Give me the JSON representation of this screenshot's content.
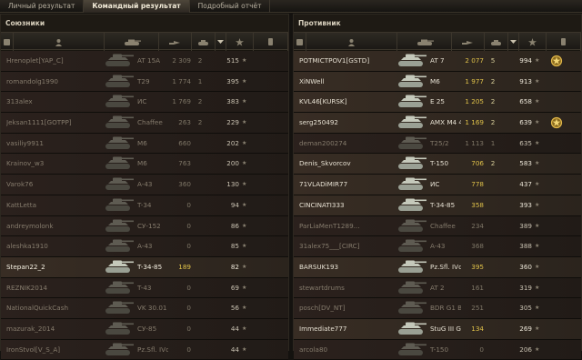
{
  "tabs": [
    "Личный результат",
    "Командный результат",
    "Подробный отчёт"
  ],
  "active_tab": 1,
  "colors": {
    "damage_highlight": "#e0c24a",
    "kills_highlight": "#d8ce9a",
    "alive_row": "#382d24",
    "dead_row": "#2b211d"
  },
  "header_icons": [
    "squad-icon",
    "player-icon",
    "tank-icon",
    "damage-icon",
    "kills-icon",
    "sort-arrow-icon",
    "experience-star-icon",
    "medal-icon"
  ],
  "allies": {
    "title": "Союзники",
    "rows": [
      {
        "name": "Hrenoplet[YAP_C]",
        "vehicle": "AT 15A",
        "damage": "2 309",
        "kills": "2",
        "xp": "515",
        "alive": false,
        "medal": false
      },
      {
        "name": "romandolg1990",
        "vehicle": "T29",
        "damage": "1 774",
        "kills": "1",
        "xp": "395",
        "alive": false,
        "medal": false
      },
      {
        "name": "313alex",
        "vehicle": "ИС",
        "damage": "1 769",
        "kills": "2",
        "xp": "383",
        "alive": false,
        "medal": false
      },
      {
        "name": "Jeksan1111[GOTPP]",
        "vehicle": "Chaffee",
        "damage": "263",
        "kills": "2",
        "xp": "229",
        "alive": false,
        "medal": false
      },
      {
        "name": "vasiliy9911",
        "vehicle": "M6",
        "damage": "660",
        "kills": "",
        "xp": "202",
        "alive": false,
        "medal": false
      },
      {
        "name": "Krainov_w3",
        "vehicle": "M6",
        "damage": "763",
        "kills": "",
        "xp": "200",
        "alive": false,
        "medal": false
      },
      {
        "name": "Varok76",
        "vehicle": "A-43",
        "damage": "360",
        "kills": "",
        "xp": "130",
        "alive": false,
        "medal": false
      },
      {
        "name": "KattLetta",
        "vehicle": "T-34",
        "damage": "0",
        "kills": "",
        "xp": "94",
        "alive": false,
        "medal": false
      },
      {
        "name": "andreymolonk",
        "vehicle": "СУ-152",
        "damage": "0",
        "kills": "",
        "xp": "86",
        "alive": false,
        "medal": false
      },
      {
        "name": "aleshka1910",
        "vehicle": "A-43",
        "damage": "0",
        "kills": "",
        "xp": "85",
        "alive": false,
        "medal": false
      },
      {
        "name": "Stepan22_2",
        "vehicle": "T-34-85",
        "damage": "189",
        "kills": "",
        "xp": "82",
        "alive": true,
        "self": true,
        "medal": false
      },
      {
        "name": "REZNIK2014",
        "vehicle": "T-43",
        "damage": "0",
        "kills": "",
        "xp": "69",
        "alive": false,
        "medal": false
      },
      {
        "name": "NationalQuickCash",
        "vehicle": "VK 30.01 H",
        "damage": "0",
        "kills": "",
        "xp": "56",
        "alive": false,
        "medal": false
      },
      {
        "name": "mazurak_2014",
        "vehicle": "СУ-85",
        "damage": "0",
        "kills": "",
        "xp": "44",
        "alive": false,
        "medal": false
      },
      {
        "name": "IronStvol[V_S_A]",
        "vehicle": "Pz.Sfl. IVc",
        "damage": "0",
        "kills": "",
        "xp": "44",
        "alive": false,
        "medal": false
      }
    ]
  },
  "enemies": {
    "title": "Противник",
    "rows": [
      {
        "name": "POTMICTPOV1[GSTD]",
        "vehicle": "AT 7",
        "damage": "2 077",
        "kills": "5",
        "xp": "994",
        "alive": true,
        "medal": true
      },
      {
        "name": "XiNWell",
        "vehicle": "M6",
        "damage": "1 977",
        "kills": "2",
        "xp": "913",
        "alive": true,
        "medal": false
      },
      {
        "name": "KVL46[KURSK]",
        "vehicle": "E 25",
        "damage": "1 205",
        "kills": "2",
        "xp": "658",
        "alive": true,
        "medal": false
      },
      {
        "name": "serg250492",
        "vehicle": "AMX M4 45",
        "damage": "1 169",
        "kills": "2",
        "xp": "639",
        "alive": true,
        "medal": true
      },
      {
        "name": "deman200274",
        "vehicle": "T25/2",
        "damage": "1 113",
        "kills": "1",
        "xp": "635",
        "alive": false,
        "medal": false
      },
      {
        "name": "Denis_Skvorcov",
        "vehicle": "T-150",
        "damage": "706",
        "kills": "2",
        "xp": "583",
        "alive": true,
        "medal": false
      },
      {
        "name": "71VLADiMIR77",
        "vehicle": "ИС",
        "damage": "778",
        "kills": "",
        "xp": "437",
        "alive": true,
        "medal": false
      },
      {
        "name": "CINCINATI333",
        "vehicle": "T-34-85",
        "damage": "358",
        "kills": "",
        "xp": "393",
        "alive": true,
        "medal": false
      },
      {
        "name": "ParLiaMenT1289...",
        "vehicle": "Chaffee",
        "damage": "234",
        "kills": "",
        "xp": "389",
        "alive": false,
        "medal": false
      },
      {
        "name": "31alex75___[CIRC]",
        "vehicle": "A-43",
        "damage": "368",
        "kills": "",
        "xp": "388",
        "alive": false,
        "medal": false
      },
      {
        "name": "BARSUK193",
        "vehicle": "Pz.Sfl. IVc",
        "damage": "395",
        "kills": "",
        "xp": "360",
        "alive": true,
        "medal": false
      },
      {
        "name": "stewartdrums",
        "vehicle": "AT 2",
        "damage": "161",
        "kills": "",
        "xp": "319",
        "alive": false,
        "medal": false
      },
      {
        "name": "posch[DV_NT]",
        "vehicle": "BDR G1 B",
        "damage": "251",
        "kills": "",
        "xp": "305",
        "alive": false,
        "medal": false
      },
      {
        "name": "Immediate777",
        "vehicle": "StuG III G",
        "damage": "134",
        "kills": "",
        "xp": "269",
        "alive": true,
        "medal": false
      },
      {
        "name": "arcola80",
        "vehicle": "T-150",
        "damage": "0",
        "kills": "",
        "xp": "206",
        "alive": false,
        "medal": false
      }
    ]
  }
}
